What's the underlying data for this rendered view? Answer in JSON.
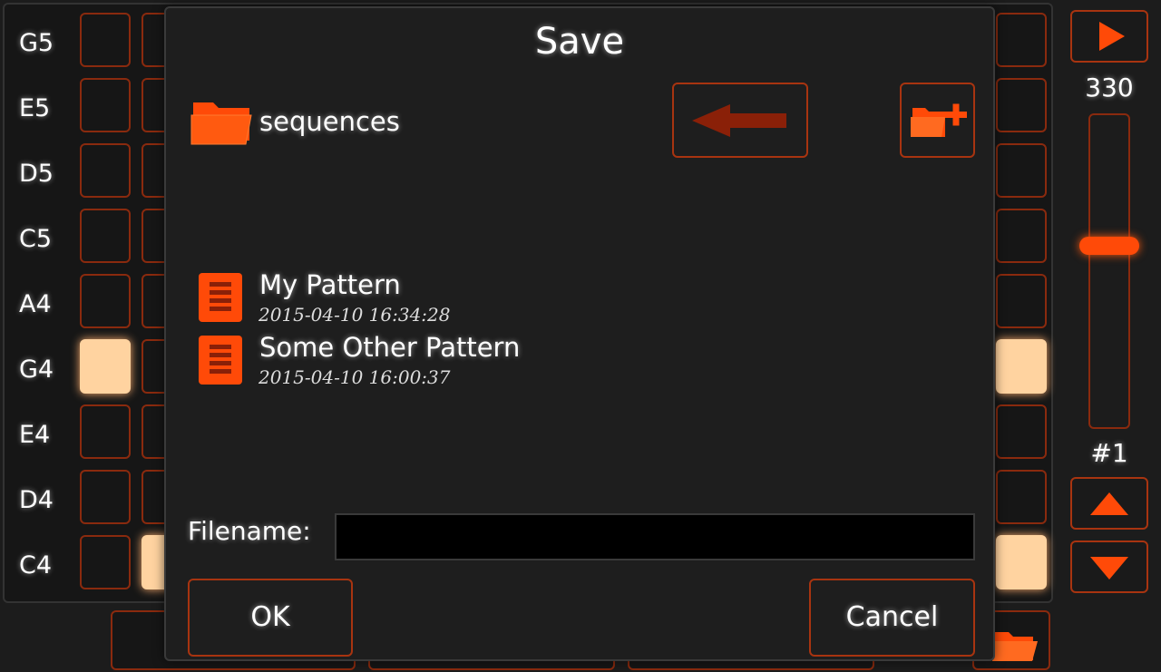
{
  "sequencer": {
    "notes": [
      "G5",
      "E5",
      "D5",
      "C5",
      "A4",
      "G4",
      "E4",
      "D4",
      "C4"
    ]
  },
  "transport": {
    "tempo": "330",
    "pattern_number": "#1"
  },
  "dialog": {
    "title": "Save",
    "folder": "sequences",
    "files": [
      {
        "name": "My Pattern",
        "date": "2015-04-10 16:34:28"
      },
      {
        "name": "Some Other Pattern",
        "date": "2015-04-10 16:00:37"
      }
    ],
    "filename_label": "Filename:",
    "filename_value": "",
    "ok_label": "OK",
    "cancel_label": "Cancel"
  },
  "colors": {
    "accent": "#ff4a08",
    "border": "#a83410",
    "active_step": "#ffd3a0"
  }
}
